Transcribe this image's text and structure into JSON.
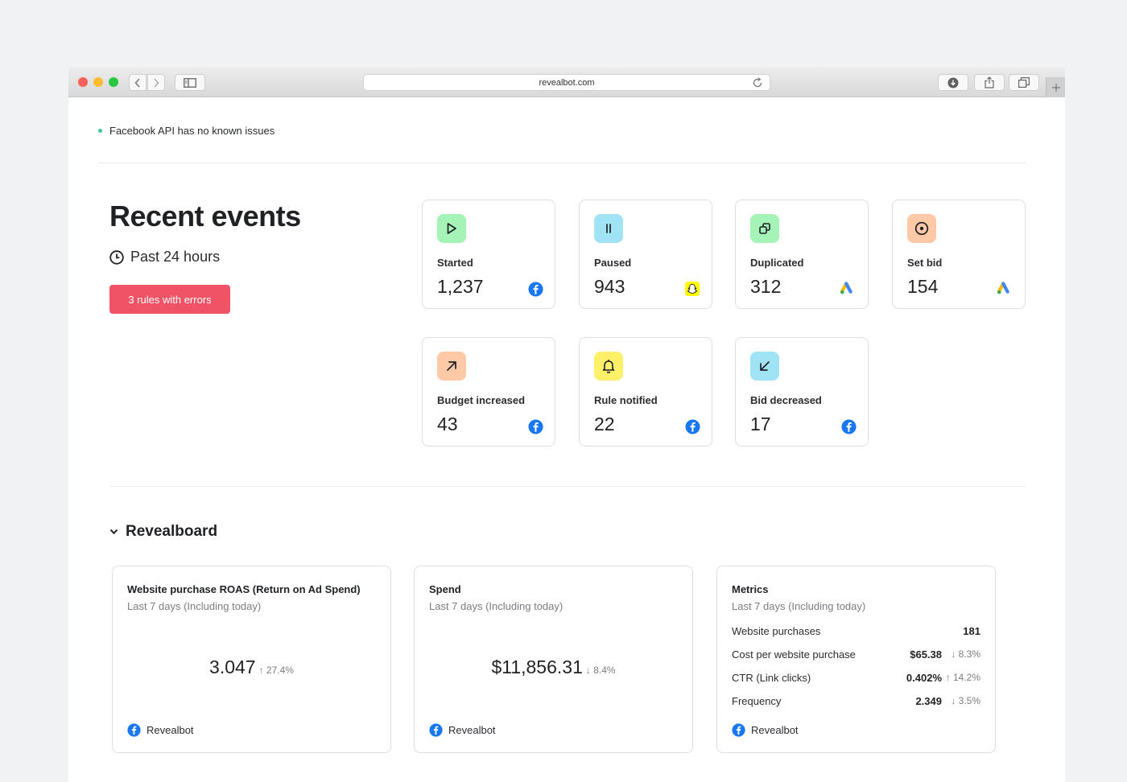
{
  "browser": {
    "url": "revealbot.com"
  },
  "status": {
    "text": "Facebook API has no known issues",
    "color": "#3ec79a"
  },
  "recent_events": {
    "title": "Recent events",
    "period": "Past 24 hours",
    "errors_button": "3 rules with errors",
    "cards": [
      {
        "label": "Started",
        "value": "1,237",
        "icon": "play-icon",
        "icon_bg": "#a6f3b8",
        "platform": "facebook-icon"
      },
      {
        "label": "Paused",
        "value": "943",
        "icon": "pause-icon",
        "icon_bg": "#9fe3f5",
        "platform": "snapchat-icon"
      },
      {
        "label": "Duplicated",
        "value": "312",
        "icon": "copy-icon",
        "icon_bg": "#a6f3b8",
        "platform": "google-ads-icon"
      },
      {
        "label": "Set bid",
        "value": "154",
        "icon": "target-icon",
        "icon_bg": "#ffc9a8",
        "platform": "google-ads-icon"
      },
      {
        "label": "Budget increased",
        "value": "43",
        "icon": "arrow-up-right-icon",
        "icon_bg": "#ffc9a8",
        "platform": "facebook-icon"
      },
      {
        "label": "Rule notified",
        "value": "22",
        "icon": "bell-icon",
        "icon_bg": "#fff06a",
        "platform": "facebook-icon"
      },
      {
        "label": "Bid decreased",
        "value": "17",
        "icon": "arrow-down-left-icon",
        "icon_bg": "#9fe3f5",
        "platform": "facebook-icon"
      }
    ]
  },
  "revealboard": {
    "title": "Revealboard",
    "widgets": {
      "roas": {
        "title": "Website purchase ROAS (Return on Ad Spend)",
        "subtitle": "Last 7 days (Including today)",
        "value": "3.047",
        "delta": "↑ 27.4%",
        "source": "Revealbot"
      },
      "spend": {
        "title": "Spend",
        "subtitle": "Last 7 days (Including today)",
        "value": "$11,856.31",
        "delta": "↓ 8.4%",
        "source": "Revealbot"
      },
      "metrics": {
        "title": "Metrics",
        "subtitle": "Last 7 days (Including today)",
        "rows": [
          {
            "label": "Website purchases",
            "value": "181",
            "delta": ""
          },
          {
            "label": "Cost per website purchase",
            "value": "$65.38",
            "delta": "↓ 8.3%"
          },
          {
            "label": "CTR (Link clicks)",
            "value": "0.402%",
            "delta": "↑ 14.2%"
          },
          {
            "label": "Frequency",
            "value": "2.349",
            "delta": "↓ 3.5%"
          }
        ],
        "source": "Revealbot"
      }
    }
  },
  "colors": {
    "accent_error": "#f05366",
    "facebook": "#1877f2",
    "snapchat": "#fffc00"
  }
}
